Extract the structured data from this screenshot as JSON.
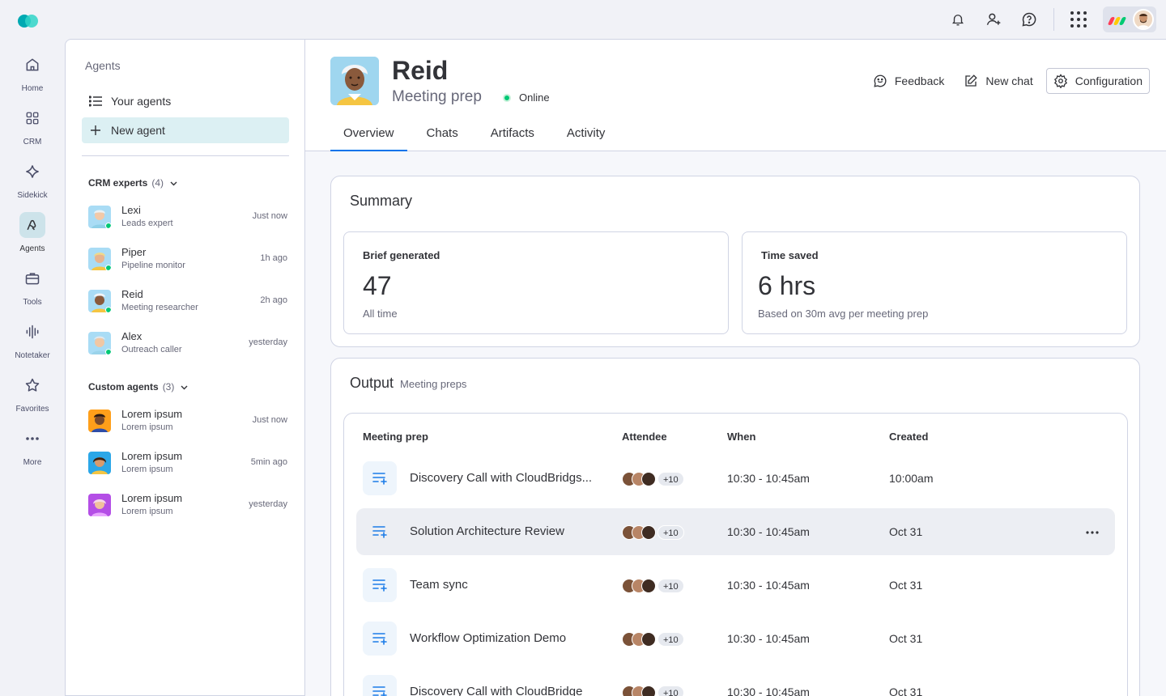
{
  "colors": {
    "accent": "#0073ea",
    "online": "#00c875",
    "teal": "#00a9b2"
  },
  "nav": {
    "items": [
      {
        "label": "Home",
        "icon": "home-icon"
      },
      {
        "label": "CRM",
        "icon": "grid-icon"
      },
      {
        "label": "Sidekick",
        "icon": "sparkle-icon"
      },
      {
        "label": "Agents",
        "icon": "agent-icon",
        "active": true
      },
      {
        "label": "Tools",
        "icon": "briefcase-icon"
      },
      {
        "label": "Notetaker",
        "icon": "waveform-icon"
      },
      {
        "label": "Favorites",
        "icon": "star-icon"
      },
      {
        "label": "More",
        "icon": "more-icon"
      }
    ]
  },
  "panel": {
    "title": "Agents",
    "your_agents": "Your agents",
    "new_agent": "New agent",
    "crm_group": {
      "label": "CRM experts",
      "count": "(4)"
    },
    "custom_group": {
      "label": "Custom agents",
      "count": "(3)"
    },
    "crm_agents": [
      {
        "name": "Lexi",
        "role": "Leads expert",
        "time": "Just now"
      },
      {
        "name": "Piper",
        "role": "Pipeline monitor",
        "time": "1h ago"
      },
      {
        "name": "Reid",
        "role": "Meeting researcher",
        "time": "2h ago"
      },
      {
        "name": "Alex",
        "role": "Outreach caller",
        "time": "yesterday"
      }
    ],
    "custom_agents": [
      {
        "name": "Lorem ipsum",
        "role": "Lorem ipsum",
        "time": "Just now"
      },
      {
        "name": "Lorem ipsum",
        "role": "Lorem ipsum",
        "time": "5min ago"
      },
      {
        "name": "Lorem ipsum",
        "role": "Lorem ipsum",
        "time": "yesterday"
      }
    ]
  },
  "agent": {
    "name": "Reid",
    "subtitle": "Meeting prep",
    "status": "Online"
  },
  "actions": {
    "feedback": "Feedback",
    "new_chat": "New chat",
    "configuration": "Configuration"
  },
  "tabs": [
    {
      "label": "Overview",
      "active": true
    },
    {
      "label": "Chats"
    },
    {
      "label": "Artifacts"
    },
    {
      "label": "Activity"
    }
  ],
  "summary": {
    "title": "Summary",
    "brief": {
      "label": "Brief generated",
      "value": "47",
      "note": "All time"
    },
    "time": {
      "label": "Time saved",
      "value": "6 hrs",
      "note": "Based on 30m avg per meeting prep"
    }
  },
  "output": {
    "title": "Output",
    "subtitle": "Meeting preps",
    "columns": {
      "name": "Meeting prep",
      "attendee": "Attendee",
      "when": "When",
      "created": "Created"
    },
    "rows": [
      {
        "name": "Discovery Call with CloudBridgs...",
        "more": "+10",
        "when": "10:30 - 10:45am",
        "created": "10:00am"
      },
      {
        "name": "Solution Architecture Review",
        "more": "+10",
        "when": "10:30 - 10:45am",
        "created": "Oct 31"
      },
      {
        "name": "Team sync",
        "more": "+10",
        "when": "10:30 - 10:45am",
        "created": "Oct 31"
      },
      {
        "name": "Workflow Optimization Demo",
        "more": "+10",
        "when": "10:30 - 10:45am",
        "created": "Oct 31"
      },
      {
        "name": "Discovery Call with CloudBridge",
        "more": "+10",
        "when": "10:30 - 10:45am",
        "created": "Oct 31"
      }
    ]
  }
}
